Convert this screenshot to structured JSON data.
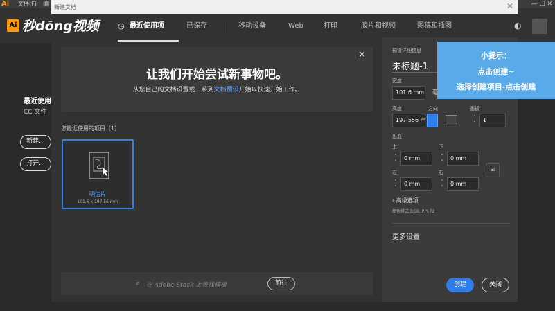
{
  "menubar": {
    "logo": "Ai",
    "items": [
      "文件(F)",
      "编"
    ],
    "window_controls": "— ☐ ✕"
  },
  "brand": {
    "ai": "Ai",
    "text": "秒dōng视频"
  },
  "dialog": {
    "title": "新建文档",
    "close": "✕"
  },
  "tabs": [
    {
      "label": "最近使用项",
      "active": true
    },
    {
      "label": "已保存"
    },
    {
      "label": "移动设备"
    },
    {
      "label": "Web"
    },
    {
      "label": "打印"
    },
    {
      "label": "胶片和视频"
    },
    {
      "label": "图稿和插图"
    }
  ],
  "home": {
    "recent": "最近使用",
    "cc": "CC 文件",
    "new_btn": "新建...",
    "open_btn": "打开..."
  },
  "welcome": {
    "heading": "让我们开始尝试新事物吧。",
    "sub_before": "从您自己的文档设置或一系列",
    "sub_link": "文档预设",
    "sub_after": "开始以快速开始工作。",
    "close": "✕"
  },
  "recent": {
    "label": "您最近使用的项目（1）",
    "card_name": "明信片",
    "card_size": "101.6 x 197.56 mm"
  },
  "stock": {
    "placeholder": "在 Adobe Stock 上查找模板",
    "button": "前往"
  },
  "right_panel": {
    "preset_label": "预设详细信息",
    "title": "未标题-1",
    "width_label": "宽度",
    "width_value": "101.6 mm",
    "unit_partial": "毫",
    "height_label": "高度",
    "height_value": "197.556 mm",
    "orientation_label": "方向",
    "artboard_label": "画板",
    "artboard_value": "1",
    "bleed_label": "出血",
    "top_label": "上",
    "bottom_label": "下",
    "left_label": "左",
    "right_label": "右",
    "top_value": "0 mm",
    "bottom_value": "0 mm",
    "left_value": "0 mm",
    "right_value": "0 mm",
    "advanced": "高级选项",
    "color_mode": "颜色模式:RGB, PPI:72",
    "more_settings": "更多设置",
    "create": "创建",
    "close": "关闭"
  },
  "tip": {
    "line1": "小提示：",
    "line2": "点击创建~",
    "line3": "选择创建项目-点击创建"
  }
}
